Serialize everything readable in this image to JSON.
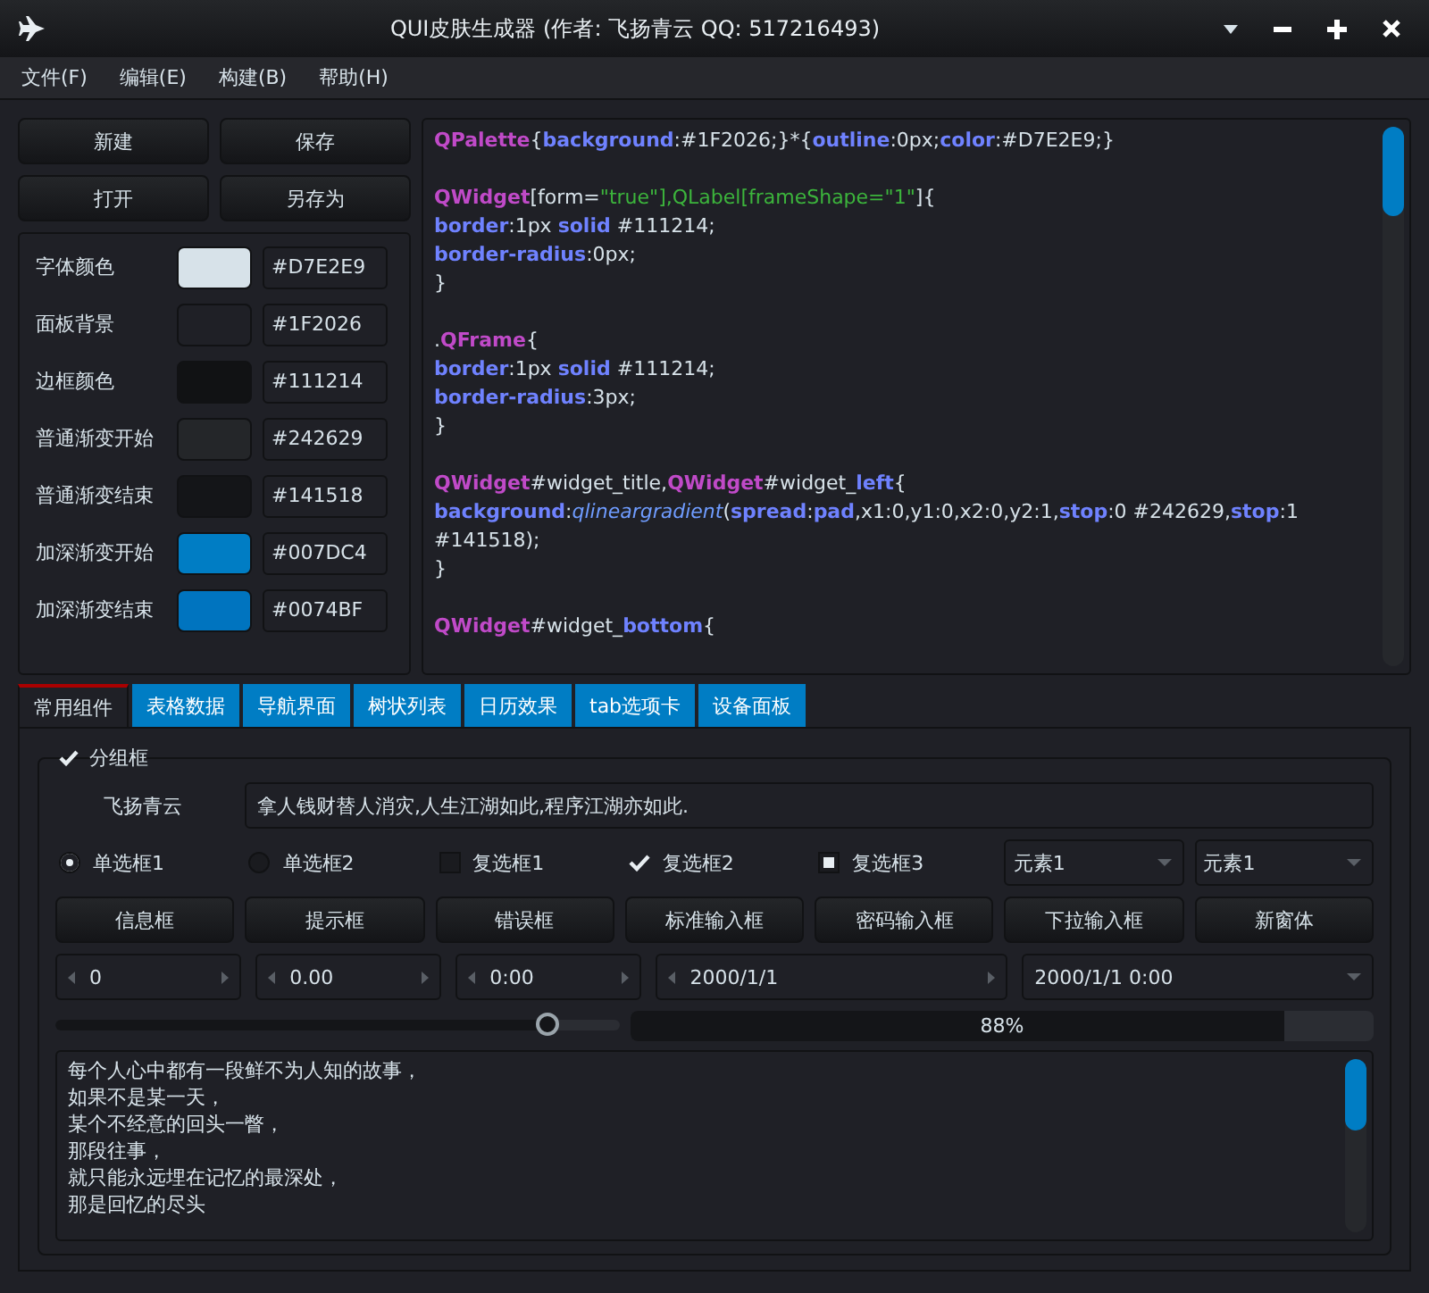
{
  "window": {
    "title": "QUI皮肤生成器 (作者: 飞扬青云  QQ: 517216493)"
  },
  "menu": [
    "文件(F)",
    "编辑(E)",
    "构建(B)",
    "帮助(H)"
  ],
  "file_buttons": [
    "新建",
    "保存",
    "打开",
    "另存为"
  ],
  "colors": [
    {
      "label": "字体颜色",
      "color": "#d7e2e9",
      "value": "#D7E2E9"
    },
    {
      "label": "面板背景",
      "color": "#1f2026",
      "value": "#1F2026"
    },
    {
      "label": "边框颜色",
      "color": "#111214",
      "value": "#111214"
    },
    {
      "label": "普通渐变开始",
      "color": "#242629",
      "value": "#242629"
    },
    {
      "label": "普通渐变结束",
      "color": "#141518",
      "value": "#141518"
    },
    {
      "label": "加深渐变开始",
      "color": "#007dc4",
      "value": "#007DC4"
    },
    {
      "label": "加深渐变结束",
      "color": "#0074bf",
      "value": "#0074BF"
    }
  ],
  "code_blocks": [
    [
      [
        {
          "kind": "keyword",
          "text": "QPalette"
        },
        {
          "kind": "plain",
          "text": "{"
        },
        {
          "kind": "prop",
          "text": "background"
        },
        {
          "kind": "plain",
          "text": ":#1F2026;}*{"
        },
        {
          "kind": "prop",
          "text": "outline"
        },
        {
          "kind": "plain",
          "text": ":0px;"
        },
        {
          "kind": "prop",
          "text": "color"
        },
        {
          "kind": "plain",
          "text": ":#D7E2E9;}"
        }
      ]
    ],
    [
      [
        {
          "kind": "keyword",
          "text": "QWidget"
        },
        {
          "kind": "plain",
          "text": "[form="
        },
        {
          "kind": "string",
          "text": "\"true\"],QLabel[frameShape=\"1\""
        },
        {
          "kind": "plain",
          "text": "]{"
        }
      ],
      [
        {
          "kind": "prop",
          "text": "border"
        },
        {
          "kind": "plain",
          "text": ":1px "
        },
        {
          "kind": "prop",
          "text": "solid"
        },
        {
          "kind": "plain",
          "text": " #111214;"
        }
      ],
      [
        {
          "kind": "prop",
          "text": "border-radius"
        },
        {
          "kind": "plain",
          "text": ":0px;"
        }
      ],
      [
        {
          "kind": "plain",
          "text": "}"
        }
      ]
    ],
    [
      [
        {
          "kind": "plain",
          "text": "."
        },
        {
          "kind": "keyword",
          "text": "QFrame"
        },
        {
          "kind": "plain",
          "text": "{"
        }
      ],
      [
        {
          "kind": "prop",
          "text": "border"
        },
        {
          "kind": "plain",
          "text": ":1px "
        },
        {
          "kind": "prop",
          "text": "solid"
        },
        {
          "kind": "plain",
          "text": " #111214;"
        }
      ],
      [
        {
          "kind": "prop",
          "text": "border-radius"
        },
        {
          "kind": "plain",
          "text": ":3px;"
        }
      ],
      [
        {
          "kind": "plain",
          "text": "}"
        }
      ]
    ],
    [
      [
        {
          "kind": "keyword",
          "text": "QWidget"
        },
        {
          "kind": "plain",
          "text": "#widget_title,"
        },
        {
          "kind": "keyword",
          "text": "QWidget"
        },
        {
          "kind": "plain",
          "text": "#widget_"
        },
        {
          "kind": "prop",
          "text": "left"
        },
        {
          "kind": "plain",
          "text": "{"
        }
      ],
      [
        {
          "kind": "prop",
          "text": "background"
        },
        {
          "kind": "plain",
          "text": ":"
        },
        {
          "kind": "func",
          "text": "qlineargradient"
        },
        {
          "kind": "plain",
          "text": "("
        },
        {
          "kind": "prop",
          "text": "spread"
        },
        {
          "kind": "plain",
          "text": ":"
        },
        {
          "kind": "prop",
          "text": "pad"
        },
        {
          "kind": "plain",
          "text": ",x1:0,y1:0,x2:0,y2:1,"
        },
        {
          "kind": "prop",
          "text": "stop"
        },
        {
          "kind": "plain",
          "text": ":0 #242629,"
        },
        {
          "kind": "prop",
          "text": "stop"
        },
        {
          "kind": "plain",
          "text": ":1"
        }
      ],
      [
        {
          "kind": "plain",
          "text": "#141518);"
        }
      ],
      [
        {
          "kind": "plain",
          "text": "}"
        }
      ]
    ],
    [
      [
        {
          "kind": "keyword",
          "text": "QWidget"
        },
        {
          "kind": "plain",
          "text": "#widget_"
        },
        {
          "kind": "prop",
          "text": "bottom"
        },
        {
          "kind": "plain",
          "text": "{"
        }
      ]
    ]
  ],
  "tabs": [
    {
      "label": "常用组件",
      "selected": true
    },
    {
      "label": "表格数据",
      "selected": false
    },
    {
      "label": "导航界面",
      "selected": false
    },
    {
      "label": "树状列表",
      "selected": false
    },
    {
      "label": "日历效果",
      "selected": false
    },
    {
      "label": "tab选项卡",
      "selected": false
    },
    {
      "label": "设备面板",
      "selected": false
    }
  ],
  "group": {
    "title": "分组框",
    "checked": true
  },
  "name_label": "飞扬青云",
  "name_field": {
    "value": "拿人钱财替人消灾,人生江湖如此,程序江湖亦如此."
  },
  "choices": [
    {
      "kind": "radio",
      "label": "单选框1",
      "checked": true
    },
    {
      "kind": "radio",
      "label": "单选框2",
      "checked": false
    },
    {
      "kind": "checkbox",
      "label": "复选框1",
      "checked": false
    },
    {
      "kind": "checkbox",
      "label": "复选框2",
      "checked": true,
      "partial": false
    },
    {
      "kind": "checkbox",
      "label": "复选框3",
      "checked": true,
      "partial": true
    }
  ],
  "combos": [
    "元素1",
    "元素1"
  ],
  "dialog_buttons": [
    "信息框",
    "提示框",
    "错误框",
    "标准输入框",
    "密码输入框",
    "下拉输入框",
    "新窗体"
  ],
  "spinners": [
    {
      "kind": "spin",
      "value": "0"
    },
    {
      "kind": "spin",
      "value": "0.00"
    },
    {
      "kind": "spin",
      "value": "0:00"
    },
    {
      "kind": "spin",
      "value": "2000/1/1"
    },
    {
      "kind": "dropdown",
      "value": "2000/1/1 0:00"
    }
  ],
  "slider": {
    "level": 0.87
  },
  "progress": {
    "level": 0.88,
    "text": "88%"
  },
  "poem": [
    "每个人心中都有一段鲜不为人知的故事，",
    "如果不是某一天，",
    "某个不经意的回头一瞥，",
    "那段往事，",
    "就只能永远埋在记忆的最深处，",
    "那是回忆的尽头"
  ]
}
